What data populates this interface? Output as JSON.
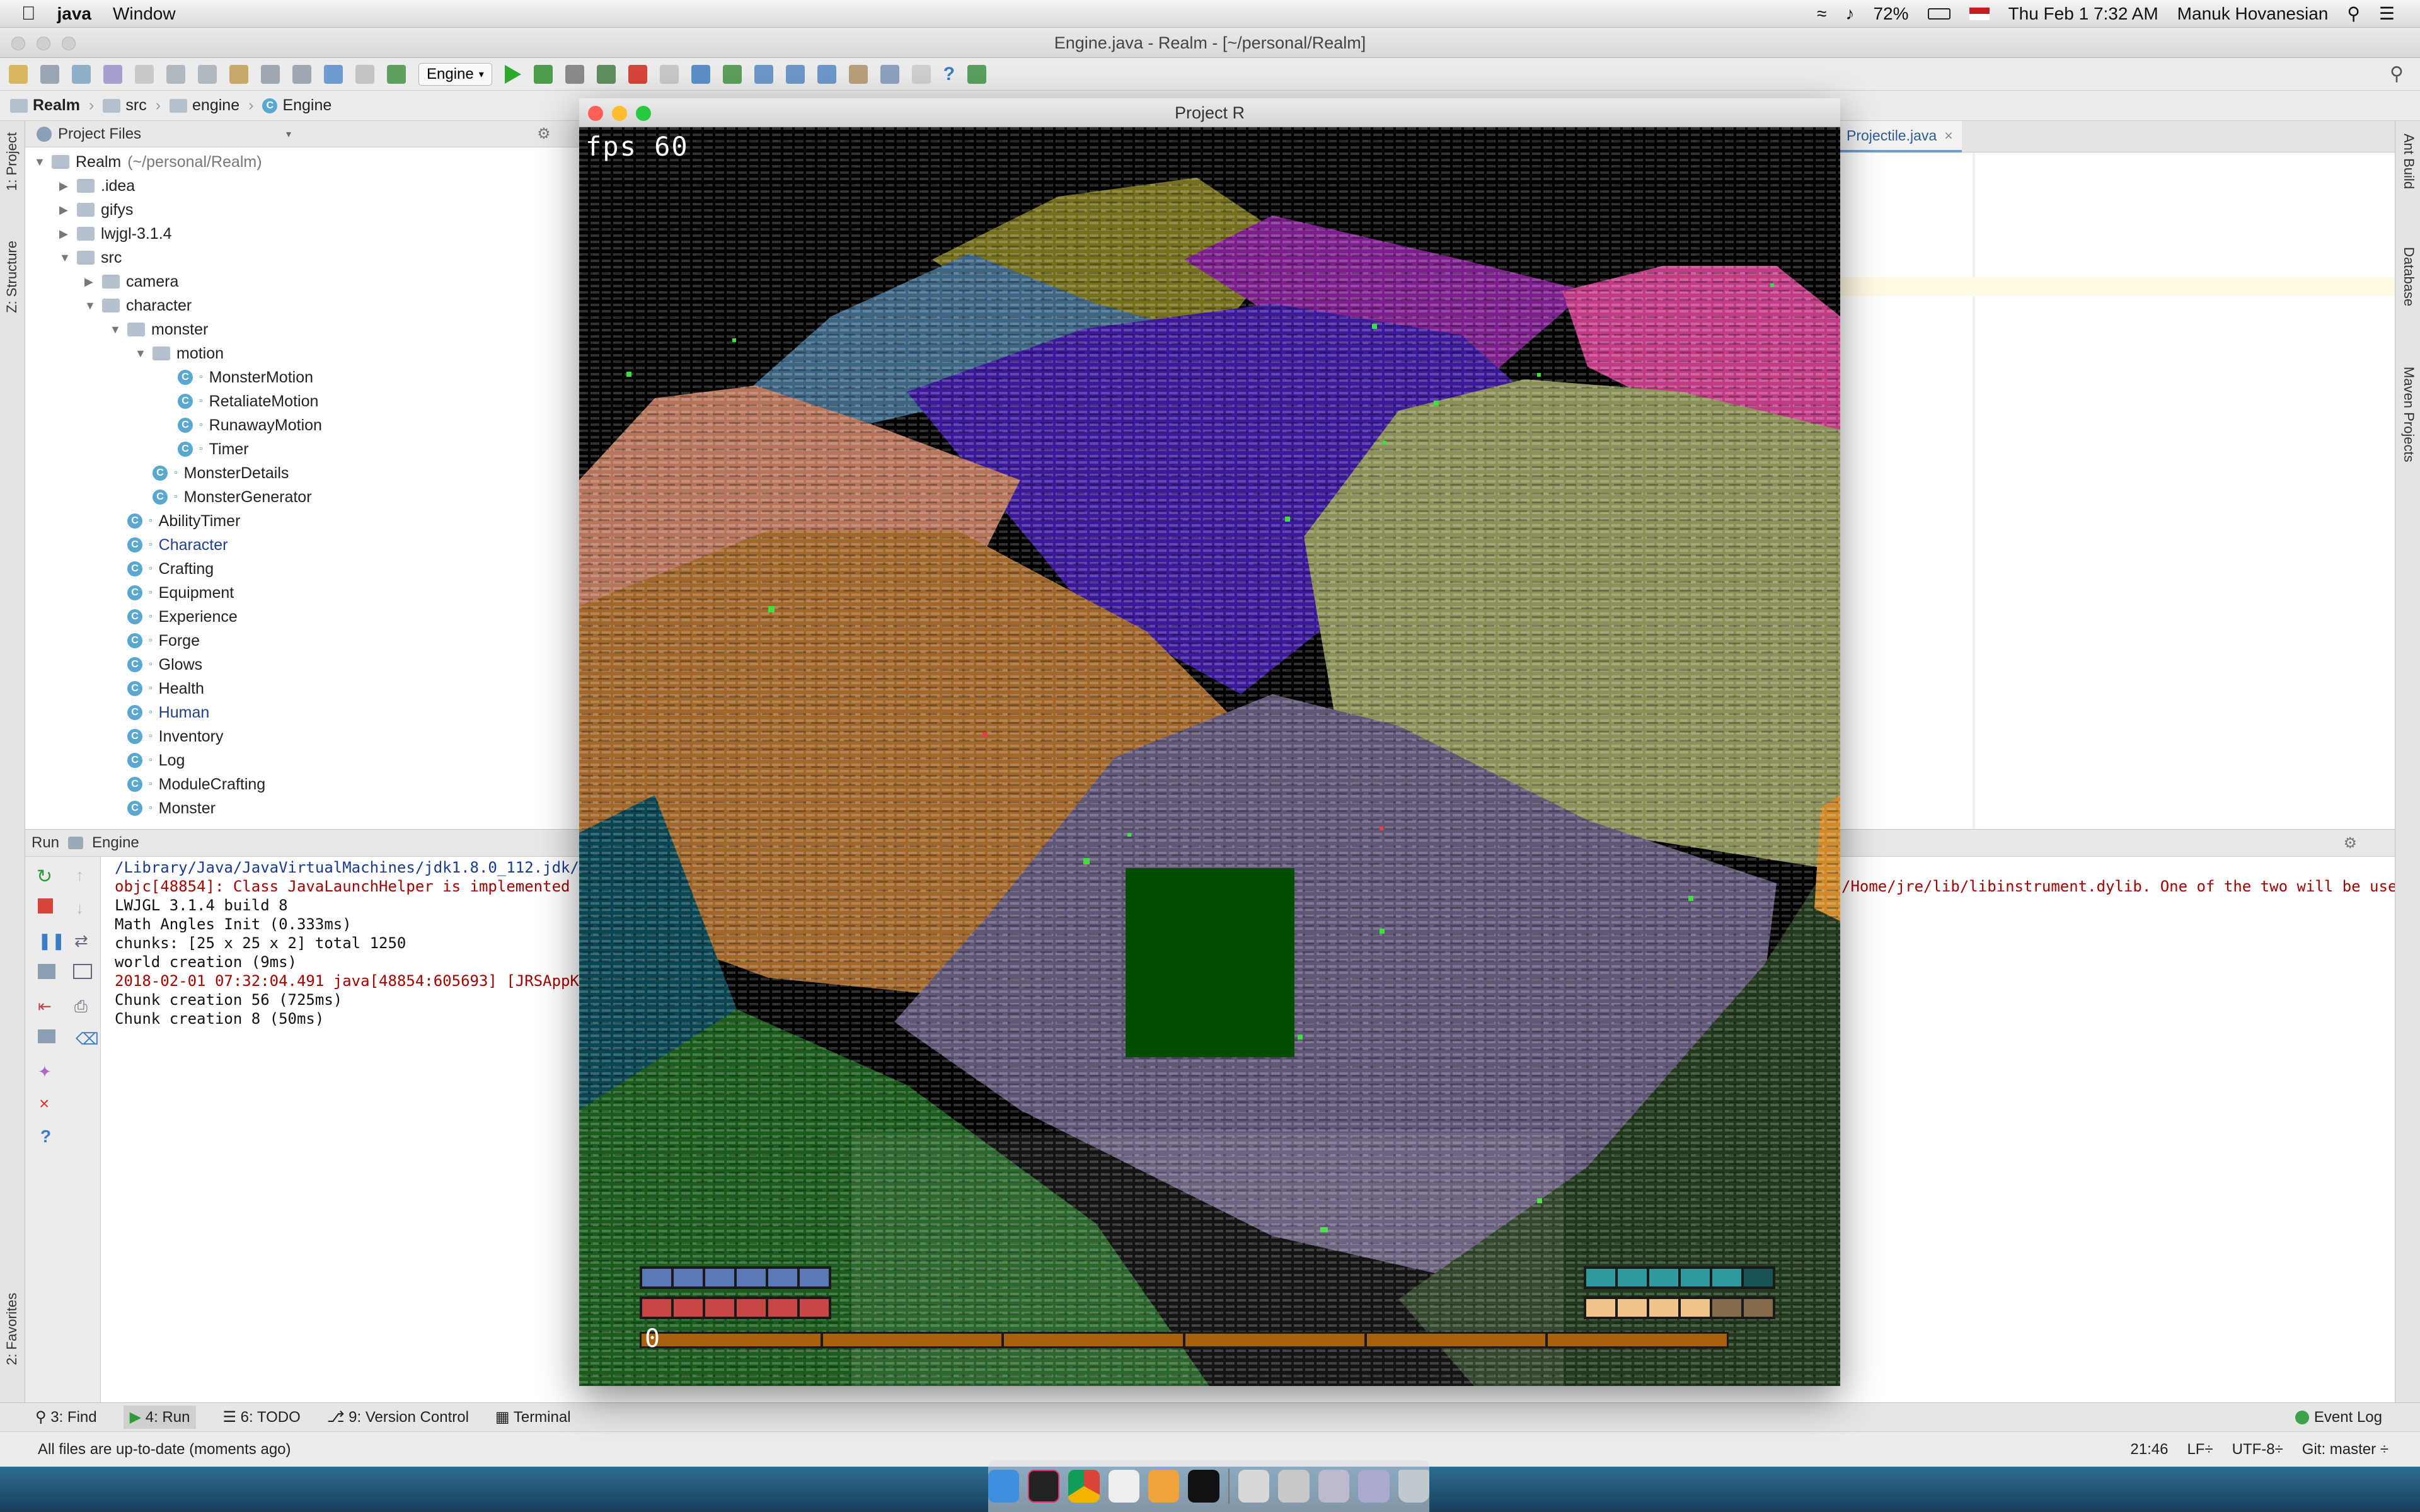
{
  "menubar": {
    "app_name": "java",
    "menu_window": "Window",
    "battery": "72%",
    "datetime": "Thu Feb 1  7:32 AM",
    "user": "Manuk Hovanesian"
  },
  "ide": {
    "title": "Engine.java - Realm - [~/personal/Realm]",
    "run_config": "Engine",
    "breadcrumb": [
      "Realm",
      "src",
      "engine",
      "Engine"
    ],
    "project_view": "Project Files",
    "editor_tab": "Projectile.java",
    "left_tabs": [
      "1: Project",
      "Z: Structure",
      "2: Favorites"
    ],
    "right_tabs": [
      "Ant Build",
      "Database",
      "Maven Projects"
    ]
  },
  "tree": [
    {
      "label": "Realm",
      "suffix": "(~/personal/Realm)",
      "type": "folder",
      "depth": 0,
      "open": true
    },
    {
      "label": ".idea",
      "type": "folder",
      "depth": 1,
      "open": false
    },
    {
      "label": "gifys",
      "type": "folder",
      "depth": 1,
      "open": false
    },
    {
      "label": "lwjgl-3.1.4",
      "type": "folder",
      "depth": 1,
      "open": false
    },
    {
      "label": "src",
      "type": "folder",
      "depth": 1,
      "open": true
    },
    {
      "label": "camera",
      "type": "folder",
      "depth": 2,
      "open": false
    },
    {
      "label": "character",
      "type": "folder",
      "depth": 2,
      "open": true
    },
    {
      "label": "monster",
      "type": "folder",
      "depth": 3,
      "open": true
    },
    {
      "label": "motion",
      "type": "folder",
      "depth": 4,
      "open": true
    },
    {
      "label": "MonsterMotion",
      "type": "class",
      "depth": 5
    },
    {
      "label": "RetaliateMotion",
      "type": "class",
      "depth": 5
    },
    {
      "label": "RunawayMotion",
      "type": "class",
      "depth": 5
    },
    {
      "label": "Timer",
      "type": "class",
      "depth": 5
    },
    {
      "label": "MonsterDetails",
      "type": "class",
      "depth": 4
    },
    {
      "label": "MonsterGenerator",
      "type": "class",
      "depth": 4
    },
    {
      "label": "AbilityTimer",
      "type": "class",
      "depth": 3
    },
    {
      "label": "Character",
      "type": "class",
      "depth": 3,
      "highlight": true
    },
    {
      "label": "Crafting",
      "type": "class",
      "depth": 3
    },
    {
      "label": "Equipment",
      "type": "class",
      "depth": 3
    },
    {
      "label": "Experience",
      "type": "class",
      "depth": 3
    },
    {
      "label": "Forge",
      "type": "class",
      "depth": 3
    },
    {
      "label": "Glows",
      "type": "class",
      "depth": 3
    },
    {
      "label": "Health",
      "type": "class",
      "depth": 3
    },
    {
      "label": "Human",
      "type": "class",
      "depth": 3,
      "highlight": true
    },
    {
      "label": "Inventory",
      "type": "class",
      "depth": 3
    },
    {
      "label": "Log",
      "type": "class",
      "depth": 3
    },
    {
      "label": "ModuleCrafting",
      "type": "class",
      "depth": 3
    },
    {
      "label": "Monster",
      "type": "class",
      "depth": 3
    }
  ],
  "run": {
    "label": "Run",
    "config": "Engine",
    "console": [
      {
        "text": "/Library/Java/JavaVirtualMachines/jdk1.8.0_112.jdk/Co",
        "kind": "path"
      },
      {
        "text": "objc[48854]: Class JavaLaunchHelper is implemented in",
        "kind": "err",
        "tail": "/Home/jre/lib/libinstrument.dylib. One of the two will be used"
      },
      {
        "text": "LWJGL 3.1.4 build 8",
        "kind": "norm"
      },
      {
        "text": "Math Angles Init (0.333ms)",
        "kind": "norm"
      },
      {
        "text": "chunks: [25 x 25 x 2] total 1250",
        "kind": "norm"
      },
      {
        "text": "world creation (9ms)",
        "kind": "norm"
      },
      {
        "text": "2018-02-01 07:32:04.491 java[48854:605693] [JRSAppKit",
        "kind": "err"
      },
      {
        "text": "Chunk creation 56 (725ms)",
        "kind": "norm"
      },
      {
        "text": "Chunk creation 8 (50ms)",
        "kind": "norm"
      }
    ]
  },
  "bottom_tabs": [
    "3: Find",
    "4: Run",
    "6: TODO",
    "9: Version Control",
    "Terminal"
  ],
  "event_log": "Event Log",
  "status": {
    "message": "All files are up-to-date (moments ago)",
    "position": "21:46",
    "line_sep": "LF÷",
    "encoding": "UTF-8÷",
    "git": "Git: master ÷"
  },
  "game": {
    "title": "Project R",
    "fps": "fps 60",
    "xp_value": "0",
    "hud": {
      "shield_color": "#5b79b5",
      "health_color": "#c94646",
      "mana_color": "#2d9aa0",
      "stamina_color": "#f2c48a",
      "xp_color": "#a8620f"
    }
  }
}
